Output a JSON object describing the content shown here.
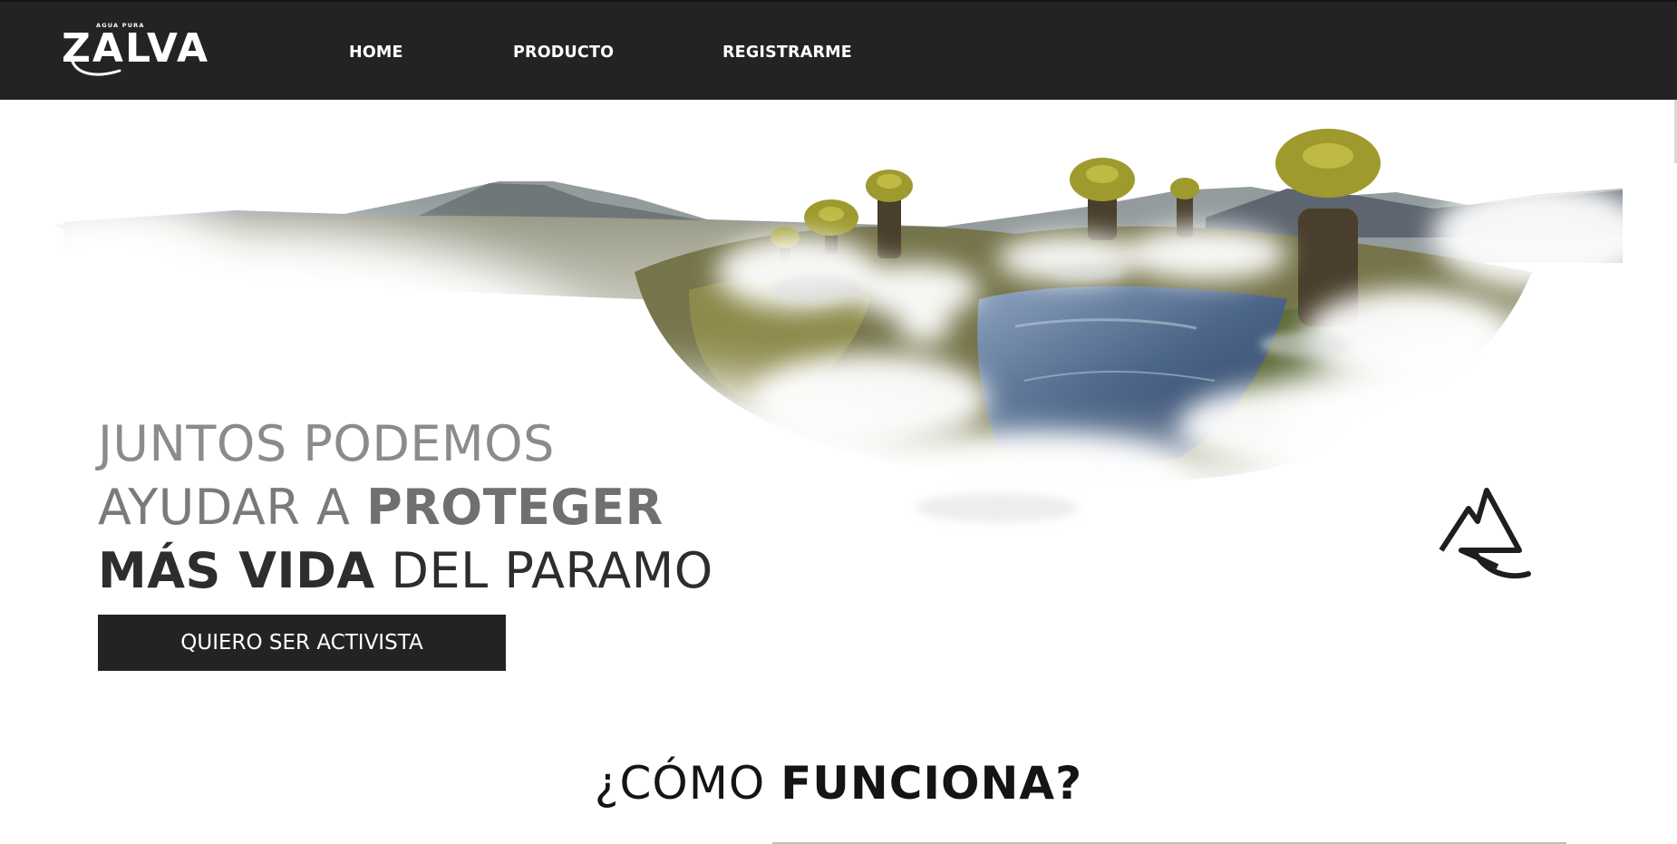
{
  "brand": {
    "tagline": "AGUA PURA",
    "name": "ZALVA"
  },
  "nav": {
    "items": [
      {
        "label": "HOME"
      },
      {
        "label": "PRODUCTO"
      },
      {
        "label": "REGISTRARME"
      }
    ]
  },
  "hero": {
    "line1": "JUNTOS PODEMOS",
    "line2_light": "AYUDAR A ",
    "line2_bold": "PROTEGER",
    "line3_bold": "MÁS VIDA",
    "line3_light": " DEL PARAMO",
    "cta_label": "QUIERO SER ACTIVISTA",
    "emblem_icon": "zalva-mountain-emblem-icon"
  },
  "how_it_works": {
    "title_light": "¿CÓMO ",
    "title_bold": "FUNCIONA?"
  },
  "colors": {
    "navbar_bg": "#232323",
    "button_bg": "#232323",
    "text_light": "#ffffff",
    "text_dark": "#141414"
  }
}
